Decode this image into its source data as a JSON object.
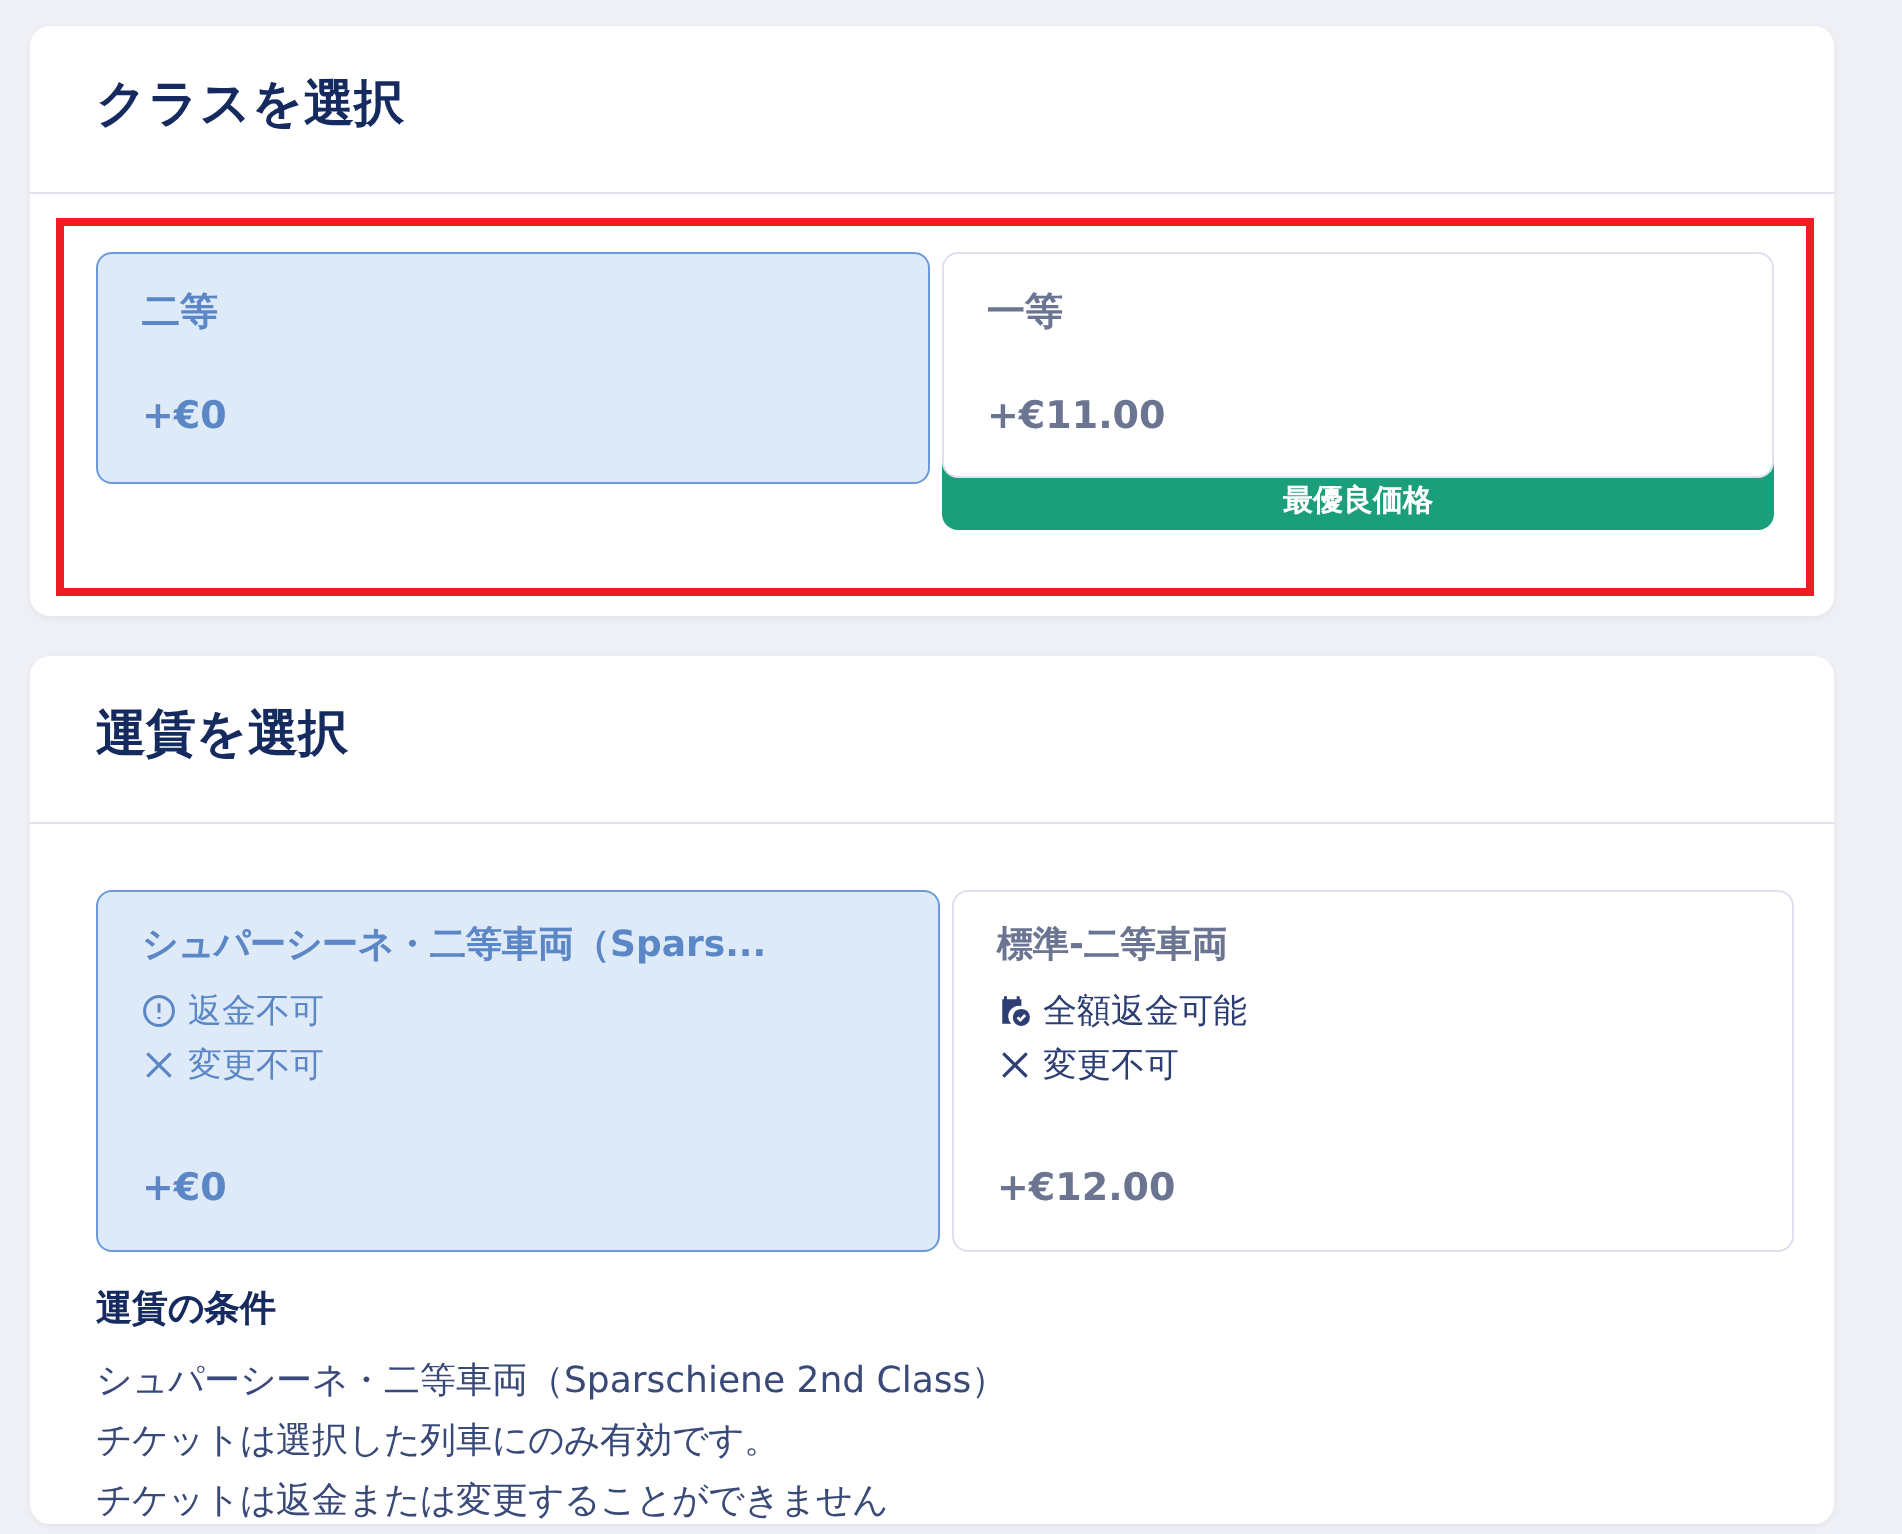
{
  "class_section": {
    "title": "クラスを選択",
    "highlighted": true,
    "options": [
      {
        "name": "二等",
        "price": "+€0",
        "selected": true
      },
      {
        "name": "一等",
        "price": "+€11.00",
        "selected": false,
        "badge": "最優良価格"
      }
    ]
  },
  "fare_section": {
    "title": "運賃を選択",
    "options": [
      {
        "name": "シュパーシーネ・二等車両（Spars...",
        "selected": true,
        "features": [
          {
            "kind": "non_refundable",
            "text": "返金不可"
          },
          {
            "kind": "no_change",
            "text": "変更不可"
          }
        ],
        "price": "+€0"
      },
      {
        "name": "標準-二等車両",
        "selected": false,
        "features": [
          {
            "kind": "refundable",
            "text": "全額返金可能"
          },
          {
            "kind": "no_change",
            "text": "変更不可"
          }
        ],
        "price": "+€12.00"
      }
    ],
    "conditions": {
      "title": "運賃の条件",
      "lines": [
        "シュパーシーネ・二等車両（Sparschiene 2nd Class）",
        "チケットは選択した列車にのみ有効です。",
        "チケットは返金または変更することができません"
      ]
    }
  }
}
